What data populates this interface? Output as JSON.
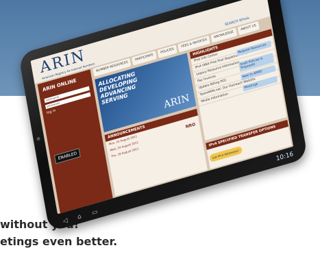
{
  "promo": {
    "line1": "without you!",
    "line2": "etings even better."
  },
  "site": {
    "logo": "ARIN",
    "tagline": "American Registry for Internet Numbers",
    "search_link": "SEARCH Whois",
    "nav": [
      "NUMBER RESOURCES",
      "PARTICIPATE",
      "POLICIES",
      "FEES & INVOICES",
      "KNOWLEDGE",
      "ABOUT US"
    ],
    "sidebar": {
      "title": "ARIN ONLINE",
      "username_placeholder": "username",
      "password_placeholder": "password",
      "login_label": "log in",
      "badge": "ENABLED"
    },
    "hero": {
      "line1": "ALLOCATING",
      "line2": "DEVELOPING",
      "line3": "ADVANCING",
      "line4": "SERVING",
      "logo": "ARIN"
    },
    "highlights": {
      "title": "HIGHLIGHTS",
      "items": [
        "IPv6 Info Center",
        "IPv4 IANA Free Pool Depletion - FAQ",
        "Legacy Resource Information",
        "Pay Invoices",
        "Update Billing POC",
        "TeamARIN.net: Our Outreach Website",
        "Media Information"
      ],
      "buttons": [
        "Request Resources",
        "Draft Policies & Proposals",
        "New to ARIN?",
        "Meetings"
      ]
    },
    "announcements": {
      "title": "ANNOUNCEMENTS",
      "items": [
        "Mon, 24 August 2011",
        "Wed, 24 August 2011",
        "Thu, 18 August 2011"
      ],
      "nro": "NRO"
    },
    "ipv4": {
      "title": "IPv4 SPECIFIED TRANSFER OPTIONS",
      "options": [
        "Got IPv4 Addresses?",
        "Need More IPv4 Addresses?",
        "Facilitating an IPv4 Transfer?"
      ]
    }
  },
  "status_bar": {
    "time": "10:16"
  }
}
